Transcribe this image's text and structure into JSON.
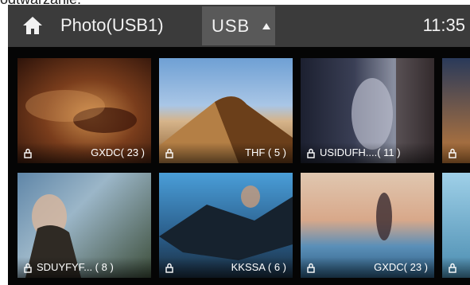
{
  "cropped_top_text": "odtwarzanie.",
  "header": {
    "title": "Photo(USB1)",
    "source_label": "USB",
    "time": "11:35"
  },
  "tiles": [
    {
      "label": "GXDC( 23 )"
    },
    {
      "label": "THF  ( 5 )"
    },
    {
      "label": "USIDUFH....( 11 )"
    },
    {
      "label": ""
    },
    {
      "label": "SDUYFYF... ( 8 )"
    },
    {
      "label": "KKSSA ( 6 )"
    },
    {
      "label": "GXDC( 23 )"
    },
    {
      "label": ""
    }
  ],
  "icons": {
    "home": "home-icon",
    "caret": "caret-up-icon",
    "lock": "lock-icon"
  }
}
